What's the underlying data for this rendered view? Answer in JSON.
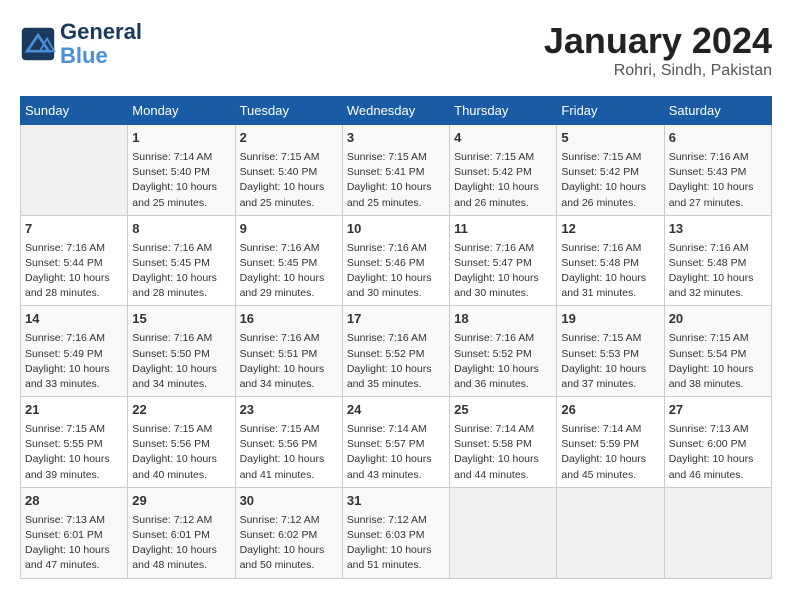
{
  "header": {
    "logo_line1": "General",
    "logo_line2": "Blue",
    "month_year": "January 2024",
    "location": "Rohri, Sindh, Pakistan"
  },
  "weekdays": [
    "Sunday",
    "Monday",
    "Tuesday",
    "Wednesday",
    "Thursday",
    "Friday",
    "Saturday"
  ],
  "weeks": [
    [
      {
        "day": "",
        "empty": true
      },
      {
        "day": "1",
        "sunrise": "7:14 AM",
        "sunset": "5:40 PM",
        "daylight": "10 hours and 25 minutes."
      },
      {
        "day": "2",
        "sunrise": "7:15 AM",
        "sunset": "5:40 PM",
        "daylight": "10 hours and 25 minutes."
      },
      {
        "day": "3",
        "sunrise": "7:15 AM",
        "sunset": "5:41 PM",
        "daylight": "10 hours and 25 minutes."
      },
      {
        "day": "4",
        "sunrise": "7:15 AM",
        "sunset": "5:42 PM",
        "daylight": "10 hours and 26 minutes."
      },
      {
        "day": "5",
        "sunrise": "7:15 AM",
        "sunset": "5:42 PM",
        "daylight": "10 hours and 26 minutes."
      },
      {
        "day": "6",
        "sunrise": "7:16 AM",
        "sunset": "5:43 PM",
        "daylight": "10 hours and 27 minutes."
      }
    ],
    [
      {
        "day": "7",
        "sunrise": "7:16 AM",
        "sunset": "5:44 PM",
        "daylight": "10 hours and 28 minutes."
      },
      {
        "day": "8",
        "sunrise": "7:16 AM",
        "sunset": "5:45 PM",
        "daylight": "10 hours and 28 minutes."
      },
      {
        "day": "9",
        "sunrise": "7:16 AM",
        "sunset": "5:45 PM",
        "daylight": "10 hours and 29 minutes."
      },
      {
        "day": "10",
        "sunrise": "7:16 AM",
        "sunset": "5:46 PM",
        "daylight": "10 hours and 30 minutes."
      },
      {
        "day": "11",
        "sunrise": "7:16 AM",
        "sunset": "5:47 PM",
        "daylight": "10 hours and 30 minutes."
      },
      {
        "day": "12",
        "sunrise": "7:16 AM",
        "sunset": "5:48 PM",
        "daylight": "10 hours and 31 minutes."
      },
      {
        "day": "13",
        "sunrise": "7:16 AM",
        "sunset": "5:48 PM",
        "daylight": "10 hours and 32 minutes."
      }
    ],
    [
      {
        "day": "14",
        "sunrise": "7:16 AM",
        "sunset": "5:49 PM",
        "daylight": "10 hours and 33 minutes."
      },
      {
        "day": "15",
        "sunrise": "7:16 AM",
        "sunset": "5:50 PM",
        "daylight": "10 hours and 34 minutes."
      },
      {
        "day": "16",
        "sunrise": "7:16 AM",
        "sunset": "5:51 PM",
        "daylight": "10 hours and 34 minutes."
      },
      {
        "day": "17",
        "sunrise": "7:16 AM",
        "sunset": "5:52 PM",
        "daylight": "10 hours and 35 minutes."
      },
      {
        "day": "18",
        "sunrise": "7:16 AM",
        "sunset": "5:52 PM",
        "daylight": "10 hours and 36 minutes."
      },
      {
        "day": "19",
        "sunrise": "7:15 AM",
        "sunset": "5:53 PM",
        "daylight": "10 hours and 37 minutes."
      },
      {
        "day": "20",
        "sunrise": "7:15 AM",
        "sunset": "5:54 PM",
        "daylight": "10 hours and 38 minutes."
      }
    ],
    [
      {
        "day": "21",
        "sunrise": "7:15 AM",
        "sunset": "5:55 PM",
        "daylight": "10 hours and 39 minutes."
      },
      {
        "day": "22",
        "sunrise": "7:15 AM",
        "sunset": "5:56 PM",
        "daylight": "10 hours and 40 minutes."
      },
      {
        "day": "23",
        "sunrise": "7:15 AM",
        "sunset": "5:56 PM",
        "daylight": "10 hours and 41 minutes."
      },
      {
        "day": "24",
        "sunrise": "7:14 AM",
        "sunset": "5:57 PM",
        "daylight": "10 hours and 43 minutes."
      },
      {
        "day": "25",
        "sunrise": "7:14 AM",
        "sunset": "5:58 PM",
        "daylight": "10 hours and 44 minutes."
      },
      {
        "day": "26",
        "sunrise": "7:14 AM",
        "sunset": "5:59 PM",
        "daylight": "10 hours and 45 minutes."
      },
      {
        "day": "27",
        "sunrise": "7:13 AM",
        "sunset": "6:00 PM",
        "daylight": "10 hours and 46 minutes."
      }
    ],
    [
      {
        "day": "28",
        "sunrise": "7:13 AM",
        "sunset": "6:01 PM",
        "daylight": "10 hours and 47 minutes."
      },
      {
        "day": "29",
        "sunrise": "7:12 AM",
        "sunset": "6:01 PM",
        "daylight": "10 hours and 48 minutes."
      },
      {
        "day": "30",
        "sunrise": "7:12 AM",
        "sunset": "6:02 PM",
        "daylight": "10 hours and 50 minutes."
      },
      {
        "day": "31",
        "sunrise": "7:12 AM",
        "sunset": "6:03 PM",
        "daylight": "10 hours and 51 minutes."
      },
      {
        "day": "",
        "empty": true
      },
      {
        "day": "",
        "empty": true
      },
      {
        "day": "",
        "empty": true
      }
    ]
  ],
  "labels": {
    "sunrise": "Sunrise:",
    "sunset": "Sunset:",
    "daylight": "Daylight:"
  }
}
